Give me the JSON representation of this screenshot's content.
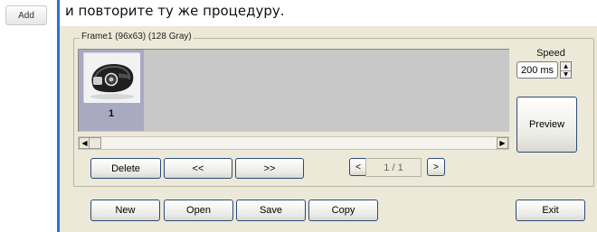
{
  "tutorial": {
    "add_label": "Add",
    "instruction": "и повторите ту же процедуру."
  },
  "group": {
    "title": "Frame1 (96x63)  (128 Gray)"
  },
  "frames": [
    {
      "number": "1"
    }
  ],
  "controls": {
    "delete": "Delete",
    "prev": "<<",
    "next": ">>",
    "page_prev": "<",
    "page_next": ">",
    "page": "1 / 1"
  },
  "speed": {
    "label": "Speed",
    "value": "200 ms"
  },
  "preview": "Preview",
  "footer": {
    "new": "New",
    "open": "Open",
    "save": "Save",
    "copy": "Copy",
    "exit": "Exit"
  },
  "colors": {
    "accent_line": "#2f6fd6",
    "dialog_bg": "#ece9d8",
    "frame_area_bg": "#c8c8c8",
    "selected_thumb_bg": "#a9a9c2"
  },
  "icons": {
    "thumbnail": "device-remote-icon",
    "spin_up": "triangle-up-icon",
    "spin_down": "triangle-down-icon",
    "scroll_left": "triangle-left-icon",
    "scroll_right": "triangle-right-icon"
  }
}
